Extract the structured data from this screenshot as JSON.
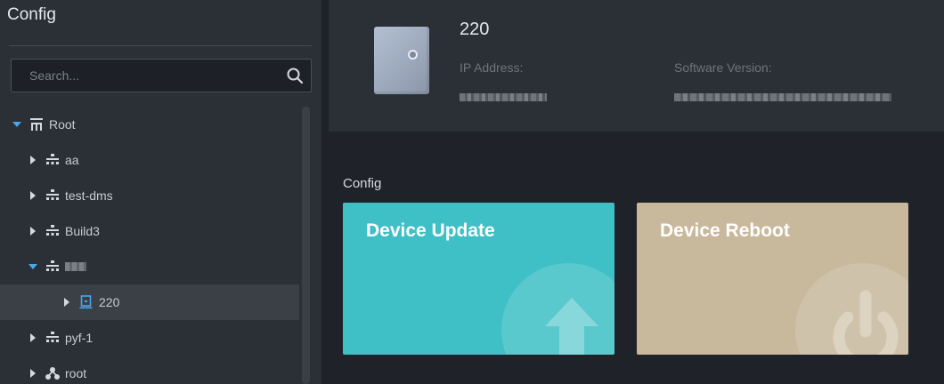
{
  "sidebar": {
    "title": "Config",
    "search": {
      "placeholder": "Search..."
    },
    "tree": [
      {
        "label": "Root",
        "icon": "org-root-icon",
        "expanded": true
      },
      {
        "label": "aa",
        "icon": "org-node-icon",
        "expanded": false
      },
      {
        "label": "test-dms",
        "icon": "org-node-icon",
        "expanded": false
      },
      {
        "label": "Build3",
        "icon": "org-node-icon",
        "expanded": false
      },
      {
        "label": "",
        "icon": "org-node-icon",
        "expanded": true,
        "blurred": true
      },
      {
        "label": "220",
        "icon": "device-icon",
        "expanded": false,
        "selected": true
      },
      {
        "label": "pyf-1",
        "icon": "org-node-icon",
        "expanded": false
      },
      {
        "label": "root",
        "icon": "user-group-icon",
        "expanded": false
      }
    ]
  },
  "device": {
    "name": "220",
    "ip_label": "IP Address:",
    "software_label": "Software Version:"
  },
  "config": {
    "section_label": "Config",
    "tiles": [
      {
        "title": "Device Update",
        "icon": "upload-arrow-icon",
        "color": "#3fc0c6"
      },
      {
        "title": "Device Reboot",
        "icon": "power-icon",
        "color": "#c8b89c"
      }
    ]
  },
  "colors": {
    "accent": "#4aa8e8",
    "sidebar_bg": "#2b2f36",
    "page_bg": "#1f2228"
  }
}
